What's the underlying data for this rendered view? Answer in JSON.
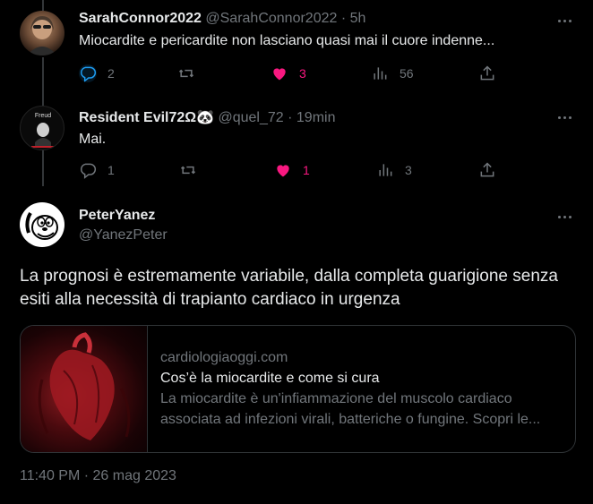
{
  "replies": [
    {
      "name": "SarahConnor2022",
      "handle": "@SarahConnor2022",
      "sep": "·",
      "time": "5h",
      "text": "Miocardite e pericardite non lasciano quasi mai il cuore indenne...",
      "counts": {
        "reply": "2",
        "retweet": "",
        "like": "3",
        "views": "56"
      },
      "liked": true
    },
    {
      "name": "Resident Evil72Ω",
      "name_emoji": "🐼",
      "handle": "@quel_72",
      "sep": "·",
      "time": "19min",
      "text": "Mai.",
      "counts": {
        "reply": "1",
        "retweet": "",
        "like": "1",
        "views": "3"
      },
      "liked": true,
      "avatar_text": "Freud"
    }
  ],
  "main_tweet": {
    "name": "PeterYanez",
    "handle": "@YanezPeter",
    "text_line1": "La prognosi è estremamente variabile, dalla completa guarigione senza",
    "text_line2": "esiti alla necessità di trapianto cardiaco in urgenza",
    "card": {
      "domain": "cardiologiaoggi.com",
      "title": "Cos’è la miocardite e come si cura",
      "desc_line1": "La miocardite è un'infiammazione del muscolo cardiaco",
      "desc_line2": "associata ad infezioni virali, batteriche o fungine. Scopri le..."
    },
    "timestamp": "11:40 PM · 26 mag 2023"
  },
  "icons": [
    "reply-icon",
    "retweet-icon",
    "like-icon",
    "views-icon",
    "share-icon",
    "more-icon"
  ],
  "colors": {
    "background": "#000000",
    "text": "#e7e9ea",
    "muted": "#71767b",
    "like": "#f91880",
    "reply_active": "#1d9bf0",
    "border": "#2f3336"
  }
}
